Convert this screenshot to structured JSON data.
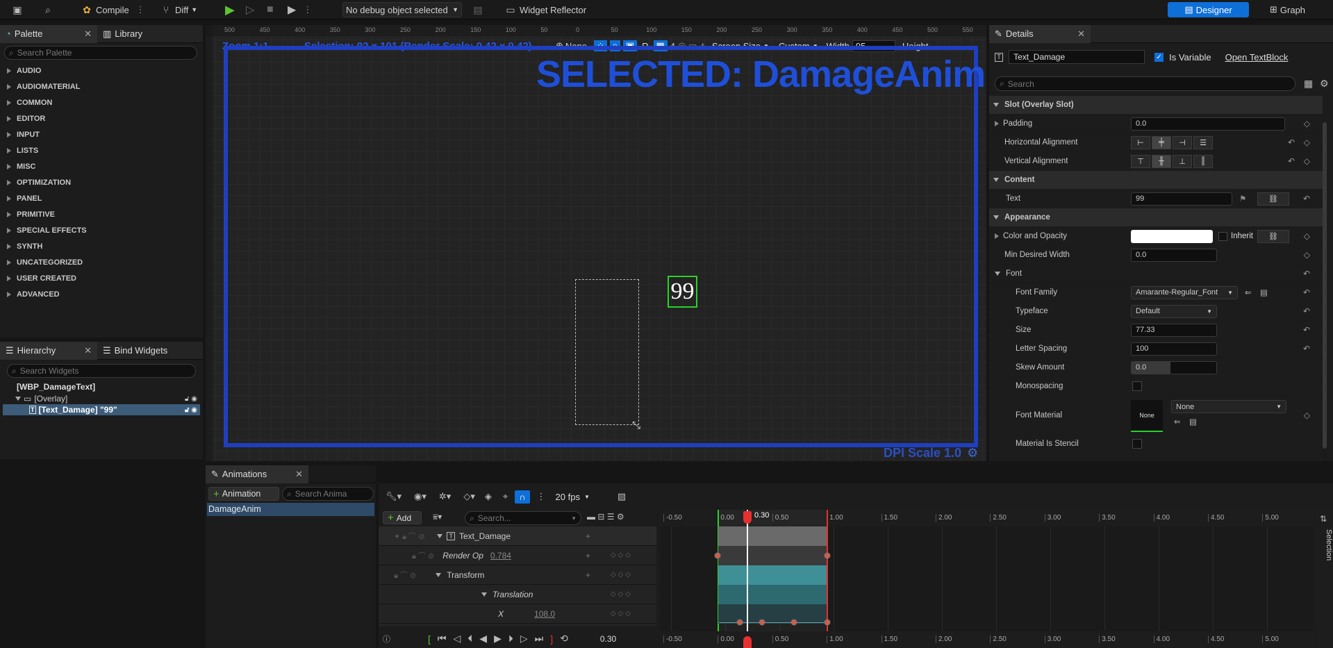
{
  "toolbar": {
    "compile": "Compile",
    "diff": "Diff",
    "debug_select": "No debug object selected",
    "widget_reflector": "Widget Reflector",
    "designer": "Designer",
    "graph": "Graph"
  },
  "palette": {
    "tab": "Palette",
    "library_tab": "Library",
    "search_placeholder": "Search Palette",
    "categories": [
      "AUDIO",
      "AUDIOMATERIAL",
      "COMMON",
      "EDITOR",
      "INPUT",
      "LISTS",
      "MISC",
      "OPTIMIZATION",
      "PANEL",
      "PRIMITIVE",
      "SPECIAL EFFECTS",
      "SYNTH",
      "UNCATEGORIZED",
      "USER CREATED",
      "ADVANCED"
    ]
  },
  "hierarchy": {
    "tab": "Hierarchy",
    "bind_tab": "Bind Widgets",
    "search_placeholder": "Search Widgets",
    "root": "[WBP_DamageText]",
    "overlay": "[Overlay]",
    "selected": "[Text_Damage] \"99\""
  },
  "canvas": {
    "zoom": "Zoom 1:1",
    "selection": "Selection: 92 x 101 (Render Scale: 0.42 x 0.42)",
    "none": "None",
    "r": "R",
    "grid_count": "4",
    "screen_size": "Screen Size",
    "custom": "Custom",
    "width_label": "Width",
    "width_value": "95",
    "height_label": "Height",
    "selected_title": "SELECTED: DamageAnim",
    "text_value": "99",
    "dpi": "DPI Scale 1.0",
    "ruler_top": [
      "500",
      "450",
      "400",
      "350",
      "300",
      "250",
      "200",
      "150",
      "100",
      "50",
      "0",
      "50",
      "100",
      "150",
      "200",
      "250",
      "300",
      "350",
      "400",
      "450",
      "500",
      "550"
    ]
  },
  "details": {
    "tab": "Details",
    "name": "Text_Damage",
    "is_variable": "Is Variable",
    "open_link": "Open TextBlock",
    "search_placeholder": "Search",
    "slot_section": "Slot (Overlay Slot)",
    "padding_label": "Padding",
    "padding_value": "0.0",
    "halign_label": "Horizontal Alignment",
    "valign_label": "Vertical Alignment",
    "content_section": "Content",
    "text_label": "Text",
    "text_value": "99",
    "appearance_section": "Appearance",
    "color_label": "Color and Opacity",
    "inherit": "Inherit",
    "min_width_label": "Min Desired Width",
    "min_width_value": "0.0",
    "font_section": "Font",
    "font_family_label": "Font Family",
    "font_family_value": "Amarante-Regular_Font",
    "typeface_label": "Typeface",
    "typeface_value": "Default",
    "size_label": "Size",
    "size_value": "77.33",
    "letter_label": "Letter Spacing",
    "letter_value": "100",
    "skew_label": "Skew Amount",
    "skew_value": "0.0",
    "mono_label": "Monospacing",
    "font_material_label": "Font Material",
    "font_material_value": "None",
    "font_material_thumb": "None",
    "stencil_label": "Material Is Stencil"
  },
  "animations": {
    "tab": "Animations",
    "add_animation": "Animation",
    "search_placeholder": "Search Anima",
    "list": [
      "DamageAnim"
    ]
  },
  "sequencer": {
    "fps": "20 fps",
    "add": "Add",
    "search_placeholder": "Search...",
    "time_label": "0.30",
    "ticks": [
      "-0.50",
      "0.00",
      "0.50",
      "1.00",
      "1.50",
      "2.00",
      "2.50",
      "3.00",
      "3.50",
      "4.00",
      "4.50",
      "5.00"
    ],
    "tracks": {
      "text_damage": "Text_Damage",
      "render_op": "Render Op",
      "render_op_value": "0.784",
      "transform": "Transform",
      "translation": "Translation",
      "x": "X",
      "x_value": "108.0"
    },
    "current_time": "0.30",
    "selection_label": "Selection"
  },
  "colors": {
    "accent": "#0e6fd8",
    "selection_blue": "#1f4fd9",
    "selected_green": "#2bd12b",
    "playhead": "#e83030",
    "teal": "#3f8f96"
  }
}
